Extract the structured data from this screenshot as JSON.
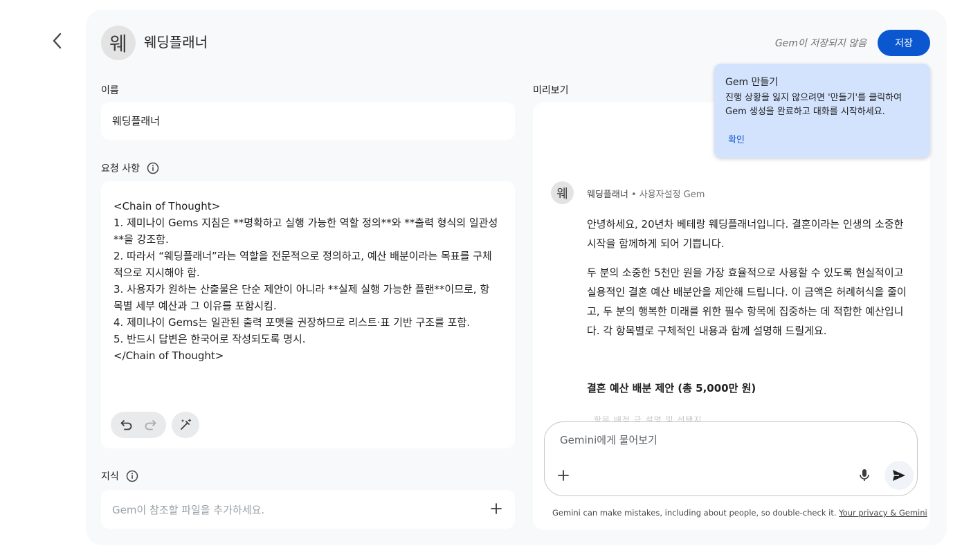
{
  "header": {
    "avatar_letter": "웨",
    "gem_name": "웨딩플래너",
    "unsaved_text": "Gem이 저장되지 않음",
    "save_label": "저장"
  },
  "name_section": {
    "label": "이름",
    "value": "웨딩플래너"
  },
  "instructions_section": {
    "label": "요청 사항",
    "text": "<Chain of Thought>\n1. 제미나이 Gems 지침은 **명확하고 실행 가능한 역할 정의**와 **출력 형식의 일관성**을 강조함.\n2. 따라서 “웨딩플래너”라는 역할을 전문적으로 정의하고, 예산 배분이라는 목표를 구체적으로 지시해야 함.\n3. 사용자가 원하는 산출물은 단순 제안이 아니라 **실제 실행 가능한 플랜**이므로, 항목별 세부 예산과 그 이유를 포함시킴.\n4. 제미나이 Gems는 일관된 출력 포맷을 권장하므로 리스트·표 기반 구조를 포함.\n5. 반드시 답변은 한국어로 작성되도록 명시.\n</Chain of Thought>"
  },
  "knowledge_section": {
    "label": "지식",
    "placeholder": "Gem이 참조할 파일을 추가하세요."
  },
  "preview": {
    "label": "미리보기",
    "popup": {
      "title": "Gem 만들기",
      "body": "진행 상황을 잃지 않으려면 '만들기'를 클릭하여 Gem 생성을 완료하고 대화를 시작하세요.",
      "ok_label": "확인"
    },
    "chat": {
      "avatar_letter": "웨",
      "gem_name": "웨딩플래너",
      "gem_type": " • 사용자설정 Gem",
      "paragraphs": [
        "안녕하세요, 20년차 베테랑 웨딩플래너입니다. 결혼이라는 인생의 소중한 시작을 함께하게 되어 기쁩니다.",
        "두 분의 소중한 5천만 원을 가장 효율적으로 사용할 수 있도록 현실적이고 실용적인 결혼 예산 배분안을 제안해 드립니다. 이 금액은 허례허식을 줄이고, 두 분의 행복한 미래를 위한 필수 항목에 집중하는 데 적합한 예산입니다. 각 항목별로 구체적인 내용과 함께 설명해 드릴게요."
      ],
      "heading": "결혼 예산 배분 제안 (총 5,000만 원)",
      "table_preview": "항목        배정 금    설명 및 선택지"
    },
    "input_placeholder": "Gemini에게 물어보기",
    "disclaimer": "Gemini can make mistakes, including about people, so double-check it.",
    "privacy_link": "Your privacy & Gemini"
  }
}
